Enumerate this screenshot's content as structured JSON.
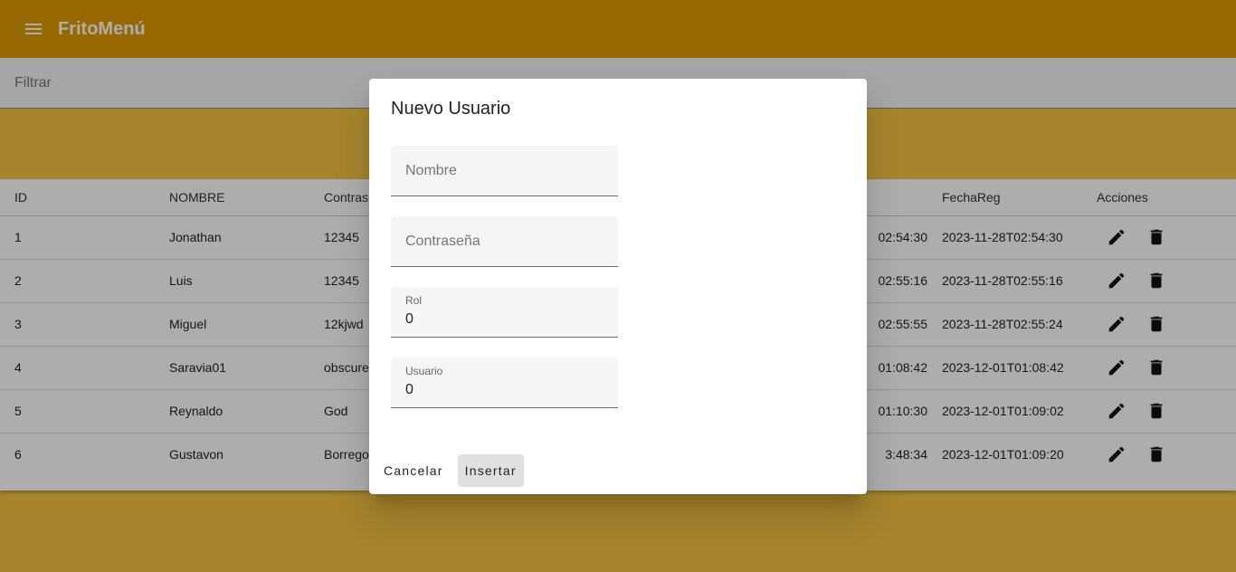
{
  "app": {
    "title": "FritoMenú"
  },
  "filter": {
    "placeholder": "Filtrar"
  },
  "table": {
    "headers": [
      "ID",
      "NOMBRE",
      "Contras",
      "",
      "",
      "FechaReg",
      "Acciones"
    ],
    "rows": [
      {
        "id": "1",
        "nombre": "Jonathan",
        "contrasena": "12345",
        "fecha_mod": "02:54:30",
        "fecha_reg": "2023-11-28T02:54:30"
      },
      {
        "id": "2",
        "nombre": "Luis",
        "contrasena": "12345",
        "fecha_mod": "02:55:16",
        "fecha_reg": "2023-11-28T02:55:16"
      },
      {
        "id": "3",
        "nombre": "Miguel",
        "contrasena": "12kjwd",
        "fecha_mod": "02:55:55",
        "fecha_reg": "2023-11-28T02:55:24"
      },
      {
        "id": "4",
        "nombre": "Saravia01",
        "contrasena": "obscure",
        "fecha_mod": "01:08:42",
        "fecha_reg": "2023-12-01T01:08:42"
      },
      {
        "id": "5",
        "nombre": "Reynaldo",
        "contrasena": "God",
        "fecha_mod": "01:10:30",
        "fecha_reg": "2023-12-01T01:09:02"
      },
      {
        "id": "6",
        "nombre": "Gustavon",
        "contrasena": "Borrego",
        "fecha_mod": "3:48:34",
        "fecha_reg": "2023-12-01T01:09:20"
      }
    ],
    "action_icons": [
      "edit-icon",
      "delete-icon"
    ]
  },
  "dialog": {
    "title": "Nuevo Usuario",
    "fields": {
      "nombre": {
        "placeholder": "Nombre",
        "value": ""
      },
      "contrasena": {
        "placeholder": "Contraseña",
        "value": ""
      },
      "rol": {
        "label": "Rol",
        "value": "0"
      },
      "usuario": {
        "label": "Usuario",
        "value": "0"
      }
    },
    "cancel_label": "Cancelar",
    "insert_label": "Insertar"
  },
  "colors": {
    "toolbar": "#e09a00",
    "background": "#f5c542",
    "backdrop": "rgba(0,0,0,0.32)"
  }
}
